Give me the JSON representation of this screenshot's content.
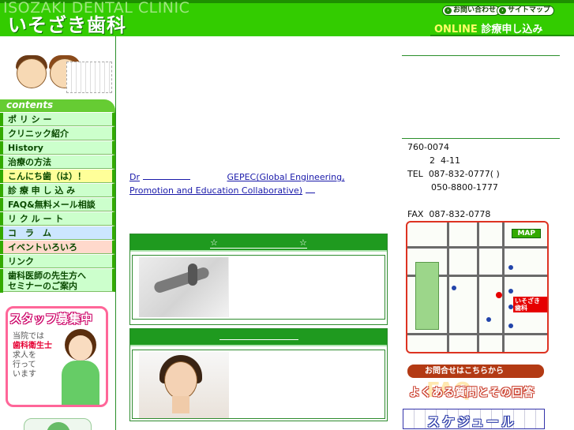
{
  "header": {
    "ghost_title": "ISOZAKI DENTAL CLINIC",
    "logo": "いそざき歯科",
    "contact_link": "お問い合わせ",
    "sitemap_link": "サイトマップ",
    "online_label": "ONLINE",
    "online_rest": "診療申し込み"
  },
  "sidebar": {
    "contents_label": "contents",
    "menu": [
      {
        "label": "ポ リ シ ー",
        "style": "green"
      },
      {
        "label": "クリニック紹介",
        "style": "green"
      },
      {
        "label": "History",
        "style": "green"
      },
      {
        "label": "治療の方法",
        "style": "green"
      },
      {
        "label": "こんにち歯（は）！",
        "style": "yellow"
      },
      {
        "label": "診 療 申 し 込 み",
        "style": "green"
      },
      {
        "label": "FAQ&無料メール相談",
        "style": "green"
      },
      {
        "label": "リ ク ル ー ト",
        "style": "green"
      },
      {
        "label": "コ　ラ　ム",
        "style": "blue"
      },
      {
        "label": "イベントいろいろ",
        "style": "pink"
      },
      {
        "label": "リンク",
        "style": "green"
      }
    ],
    "seminar_line1": "歯科医師の先生方へ",
    "seminar_line2": "セミナーのご案内",
    "staff_banner": {
      "title": "スタッフ募集中",
      "line1": "当院では",
      "line2": "歯科衛生士",
      "line3": "求人を",
      "line4": "行って",
      "line5": "います"
    }
  },
  "main": {
    "intro_link1": "Dr",
    "intro_link2": "GEPEC(Global Engineering, Promotion and Education Collaborative)",
    "box1_title_left": "☆",
    "box1_title_right": "☆",
    "box2_title": ""
  },
  "right": {
    "postal": "760-0074",
    "address": "2  4-11",
    "tel_label": "TEL",
    "tel": "087-832-0777( )",
    "tel2": "050-8800-1777",
    "fax_label": "FAX",
    "fax": "087-832-0778",
    "map_tag": "MAP",
    "map_clinic_label": "いそざき歯科",
    "contact_button": "お問合せはこちらから",
    "faq_bg": "FAQ",
    "faq_button": "よくある質問とその回答",
    "schedule_button": "スケジュール"
  },
  "colors": {
    "header_green": "#33cc00",
    "menu_green": "#ccffcc",
    "accent_red": "#e60000"
  }
}
